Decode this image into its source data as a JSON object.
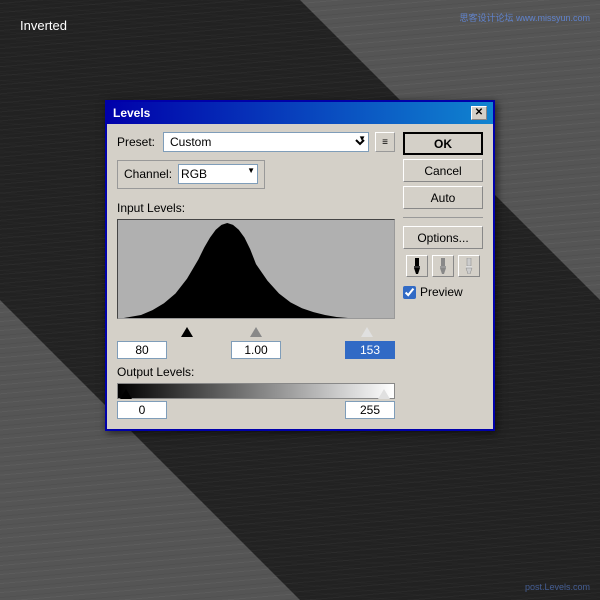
{
  "background": {
    "inverted_label": "Inverted"
  },
  "watermark": {
    "top_right_line1": "思客设计论坛 www.missyun.com",
    "bottom_right": "post.Levels.com"
  },
  "dialog": {
    "title": "Levels",
    "close_btn": "✕",
    "preset_label": "Preset:",
    "preset_value": "Custom",
    "preset_icon": "≡",
    "channel_label": "Channel:",
    "channel_value": "RGB",
    "input_levels_label": "Input Levels:",
    "input_min": "80",
    "input_mid": "1.00",
    "input_max": "153",
    "output_levels_label": "Output Levels:",
    "output_min": "0",
    "output_max": "255",
    "buttons": {
      "ok": "OK",
      "cancel": "Cancel",
      "auto": "Auto",
      "options": "Options..."
    },
    "preview_label": "Preview"
  }
}
